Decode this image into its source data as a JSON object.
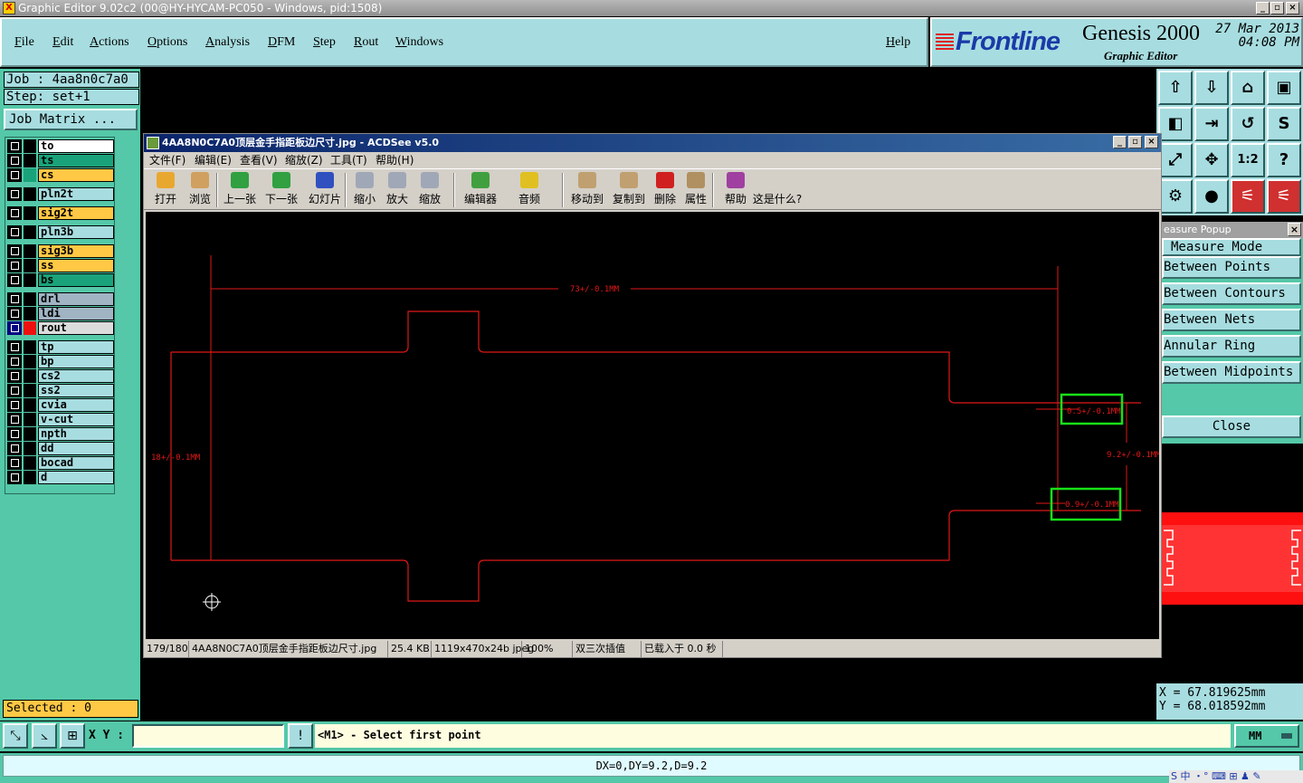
{
  "window": {
    "title": "Graphic Editor 9.02c2 (00@HY-HYCAM-PC050 - Windows, pid:1508)",
    "app_icon": "X"
  },
  "menu": [
    "File",
    "Edit",
    "Actions",
    "Options",
    "Analysis",
    "DFM",
    "Step",
    "Rout",
    "Windows"
  ],
  "help": "Help",
  "brand": {
    "logo": "Frontline",
    "title": "Genesis 2000",
    "subtitle": "Graphic Editor",
    "date": "27 Mar 2013",
    "time": "04:08 PM"
  },
  "job": {
    "job_label": "Job : 4aa8n0c7a0",
    "step_label": "Step: set+1",
    "matrix_button": "Job Matrix ..."
  },
  "layers": [
    {
      "name": "to",
      "color": "#ffffff",
      "swatch": "#000000"
    },
    {
      "name": "ts",
      "color": "#1aa37a",
      "swatch": "#000000"
    },
    {
      "name": "cs",
      "color": "#ffc845",
      "swatch": "#1aa37a"
    },
    {
      "name": "pln2t",
      "color": "#a7dde0",
      "swatch": "#000000"
    },
    {
      "name": "sig2t",
      "color": "#ffc845",
      "swatch": "#000000"
    },
    {
      "name": "pln3b",
      "color": "#a7dde0",
      "swatch": "#000000"
    },
    {
      "name": "sig3b",
      "color": "#ffc845",
      "swatch": "#000000"
    },
    {
      "name": "ss",
      "color": "#ffc845",
      "swatch": "#000000"
    },
    {
      "name": "bs",
      "color": "#1aa37a",
      "swatch": "#000000"
    },
    {
      "name": "drl",
      "color": "#a0b4c4",
      "swatch": "#000000"
    },
    {
      "name": "ldi",
      "color": "#a0b4c4",
      "swatch": "#000000"
    },
    {
      "name": "rout",
      "color": "#dcdcdc",
      "swatch": "#ee1010",
      "selected": true
    },
    {
      "name": "tp",
      "color": "#a7dde0",
      "swatch": "#000000"
    },
    {
      "name": "bp",
      "color": "#a7dde0",
      "swatch": "#000000"
    },
    {
      "name": "cs2",
      "color": "#a7dde0",
      "swatch": "#000000"
    },
    {
      "name": "ss2",
      "color": "#a7dde0",
      "swatch": "#000000"
    },
    {
      "name": "cvia",
      "color": "#a7dde0",
      "swatch": "#000000"
    },
    {
      "name": "v-cut",
      "color": "#a7dde0",
      "swatch": "#000000"
    },
    {
      "name": "npth",
      "color": "#a7dde0",
      "swatch": "#000000"
    },
    {
      "name": "dd",
      "color": "#a7dde0",
      "swatch": "#000000"
    },
    {
      "name": "bocad",
      "color": "#a7dde0",
      "swatch": "#000000"
    },
    {
      "name": "d",
      "color": "#a7dde0",
      "swatch": "#000000"
    }
  ],
  "selected": "Selected : 0",
  "tool_icons": [
    "export-icon",
    "import-icon",
    "home-icon",
    "window-icon",
    "left-icon",
    "right-icon",
    "undo-icon",
    "snap-icon",
    "fit-icon",
    "pan-icon",
    "scale-icon",
    "help-icon",
    "measure-tool-icon",
    "probe-icon",
    "signal-icon",
    "layers-icon"
  ],
  "tool_glyphs": [
    "⇧",
    "⇩",
    "⌂",
    "▣",
    "◧",
    "⇥",
    "↺",
    "S",
    "⤢",
    "✥",
    "1:2",
    "?",
    "⚙",
    "●",
    "⚟",
    "⚟"
  ],
  "measure": {
    "header": "easure Popup",
    "title": "Measure Mode",
    "items": [
      "Between Points",
      "Between Contours",
      "Between Nets",
      "Annular Ring",
      "Between Midpoints"
    ],
    "close": "Close"
  },
  "coords": {
    "x": "X = 67.819625mm",
    "y": "Y = 68.018592mm"
  },
  "bottom": {
    "xy_label": "X Y :",
    "message": "<M1> - Select first point",
    "units": "MM",
    "xy_value": ""
  },
  "status": {
    "dxdy": "DX=0,DY=9.2,D=9.2",
    "ime": "S 中 ・° ⌨ ⊞ ♟ ✎"
  },
  "acdsee": {
    "title": "4AA8N0C7A0顶层金手指距板边尺寸.jpg - ACDSee v5.0",
    "menu": [
      "文件(F)",
      "编辑(E)",
      "查看(V)",
      "缩放(Z)",
      "工具(T)",
      "帮助(H)"
    ],
    "tools": [
      {
        "label": "打开",
        "icon": "open-icon",
        "color": "#e8a830"
      },
      {
        "label": "浏览",
        "icon": "browse-icon",
        "color": "#d0a060"
      },
      {
        "label": "上一张",
        "icon": "prev-icon",
        "color": "#30a040"
      },
      {
        "label": "下一张",
        "icon": "next-icon",
        "color": "#30a040"
      },
      {
        "label": "幻灯片",
        "icon": "slideshow-icon",
        "color": "#3050c0"
      },
      {
        "label": "缩小",
        "icon": "zoom-out-icon",
        "color": "#a0a8b8"
      },
      {
        "label": "放大",
        "icon": "zoom-in-icon",
        "color": "#a0a8b8"
      },
      {
        "label": "缩放",
        "icon": "zoom-icon",
        "color": "#a0a8b8"
      },
      {
        "label": "编辑器",
        "icon": "editor-icon",
        "color": "#40a040"
      },
      {
        "label": "音频",
        "icon": "audio-icon",
        "color": "#e0c020"
      },
      {
        "label": "移动到",
        "icon": "move-icon",
        "color": "#c0a070"
      },
      {
        "label": "复制到",
        "icon": "copy-icon",
        "color": "#c0a070"
      },
      {
        "label": "删除",
        "icon": "delete-icon",
        "color": "#d02020"
      },
      {
        "label": "属性",
        "icon": "properties-icon",
        "color": "#b09060"
      },
      {
        "label": "帮助",
        "icon": "help-book-icon",
        "color": "#a040a0"
      },
      {
        "label": "这是什么?",
        "icon": "whats-this-icon",
        "color": "#d4d0c8"
      }
    ],
    "drawing": {
      "dim_top": "73+/-0.1MM",
      "dim_left": "18+/-0.1MM",
      "dim_finger1": "0.5+/-0.1MM",
      "dim_finger2": "0.9+/-0.1MM",
      "dim_right": "9.2+/-0.1MM",
      "line_color": "#e01818",
      "highlight_color": "#18e018"
    },
    "status": [
      "179/180",
      "4AA8N0C7A0顶层金手指距板边尺寸.jpg",
      "25.4 KB",
      "1119x470x24b jpeg",
      "100%",
      "双三次插值",
      "已载入于 0.0 秒"
    ]
  }
}
